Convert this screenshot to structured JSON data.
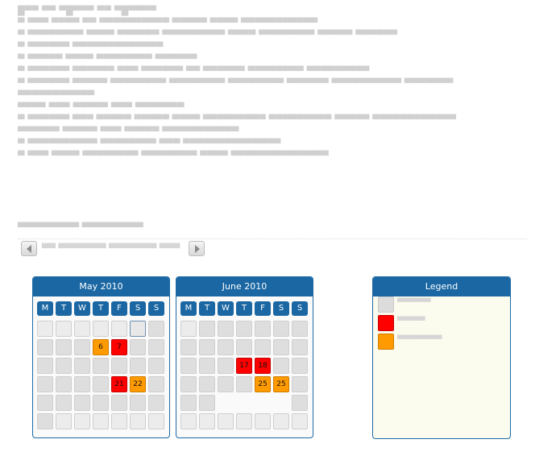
{
  "months": [
    {
      "title": "May 2010",
      "days": [
        {
          "t": "",
          "c": "out"
        },
        {
          "t": "",
          "c": "out"
        },
        {
          "t": "",
          "c": "out"
        },
        {
          "t": "",
          "c": "out"
        },
        {
          "t": "",
          "c": "out"
        },
        {
          "t": "",
          "c": "today"
        },
        {
          "t": "",
          "c": ""
        },
        {
          "t": "",
          "c": ""
        },
        {
          "t": "",
          "c": ""
        },
        {
          "t": "",
          "c": ""
        },
        {
          "t": "6",
          "c": "orange"
        },
        {
          "t": "7",
          "c": "red"
        },
        {
          "t": "",
          "c": ""
        },
        {
          "t": "",
          "c": ""
        },
        {
          "t": "",
          "c": ""
        },
        {
          "t": "",
          "c": ""
        },
        {
          "t": "",
          "c": ""
        },
        {
          "t": "",
          "c": ""
        },
        {
          "t": "",
          "c": ""
        },
        {
          "t": "",
          "c": ""
        },
        {
          "t": "",
          "c": ""
        },
        {
          "t": "",
          "c": ""
        },
        {
          "t": "",
          "c": ""
        },
        {
          "t": "",
          "c": ""
        },
        {
          "t": "",
          "c": ""
        },
        {
          "t": "21",
          "c": "red"
        },
        {
          "t": "22",
          "c": "orange"
        },
        {
          "t": "",
          "c": ""
        },
        {
          "t": "",
          "c": ""
        },
        {
          "t": "",
          "c": ""
        },
        {
          "t": "",
          "c": ""
        },
        {
          "t": "",
          "c": ""
        },
        {
          "t": "",
          "c": ""
        },
        {
          "t": "",
          "c": ""
        },
        {
          "t": "",
          "c": ""
        },
        {
          "t": "",
          "c": ""
        },
        {
          "t": "",
          "c": "out"
        },
        {
          "t": "",
          "c": "out"
        },
        {
          "t": "",
          "c": "out"
        },
        {
          "t": "",
          "c": "out"
        },
        {
          "t": "",
          "c": "out"
        },
        {
          "t": "",
          "c": "out"
        }
      ]
    },
    {
      "title": "June 2010",
      "days": [
        {
          "t": "",
          "c": "out"
        },
        {
          "t": "",
          "c": ""
        },
        {
          "t": "",
          "c": ""
        },
        {
          "t": "",
          "c": ""
        },
        {
          "t": "",
          "c": ""
        },
        {
          "t": "",
          "c": ""
        },
        {
          "t": "",
          "c": ""
        },
        {
          "t": "",
          "c": ""
        },
        {
          "t": "",
          "c": ""
        },
        {
          "t": "",
          "c": ""
        },
        {
          "t": "",
          "c": ""
        },
        {
          "t": "",
          "c": ""
        },
        {
          "t": "",
          "c": ""
        },
        {
          "t": "",
          "c": ""
        },
        {
          "t": "",
          "c": ""
        },
        {
          "t": "",
          "c": ""
        },
        {
          "t": "",
          "c": ""
        },
        {
          "t": "17",
          "c": "red"
        },
        {
          "t": "18",
          "c": "red"
        },
        {
          "t": "",
          "c": ""
        },
        {
          "t": "",
          "c": ""
        },
        {
          "t": "",
          "c": ""
        },
        {
          "t": "",
          "c": ""
        },
        {
          "t": "",
          "c": ""
        },
        {
          "t": "",
          "c": ""
        },
        {
          "t": "25",
          "c": "orange"
        },
        {
          "t": "25",
          "c": "orange"
        },
        {
          "t": "",
          "c": ""
        },
        {
          "t": "",
          "c": ""
        },
        {
          "t": "",
          "c": ""
        },
        {
          "t": "",
          "c": "empty"
        },
        {
          "t": "",
          "c": "empty"
        },
        {
          "t": "",
          "c": "empty"
        },
        {
          "t": "",
          "c": "empty"
        },
        {
          "t": "",
          "c": ""
        },
        {
          "t": "",
          "c": "out"
        },
        {
          "t": "",
          "c": "out"
        },
        {
          "t": "",
          "c": "out"
        },
        {
          "t": "",
          "c": "out"
        },
        {
          "t": "",
          "c": "out"
        },
        {
          "t": "",
          "c": "out"
        },
        {
          "t": "",
          "c": "out"
        }
      ]
    }
  ],
  "weekdays": [
    "M",
    "T",
    "W",
    "T",
    "F",
    "S",
    "S"
  ],
  "legend": {
    "title": "Legend",
    "items": [
      {
        "color": "grey"
      },
      {
        "color": "red"
      },
      {
        "color": "orange"
      }
    ]
  },
  "colors": {
    "header_blue": "#1a67a3",
    "booked_red": "#ff0000",
    "partial_orange": "#ff9a00"
  }
}
